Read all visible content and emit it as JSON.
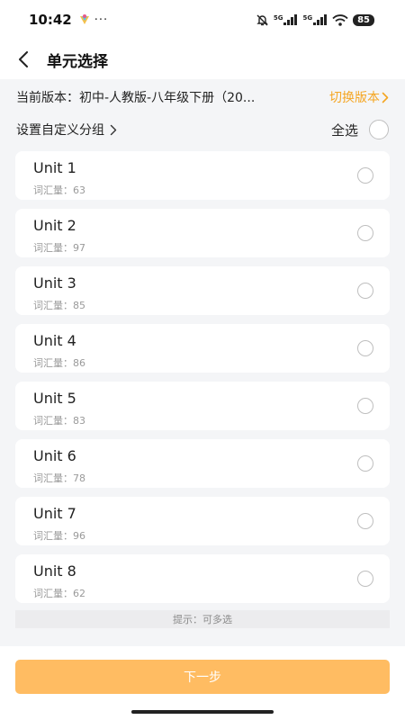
{
  "status_bar": {
    "time": "10:42",
    "dots": "···",
    "network_label_1": "5G",
    "network_label_2": "5G",
    "battery": "85"
  },
  "header": {
    "title": "单元选择"
  },
  "version": {
    "text": "当前版本：初中-人教版-八年级下册（20...",
    "switch_label": "切换版本"
  },
  "group": {
    "custom_label": "设置自定义分组",
    "select_all_label": "全选"
  },
  "units": [
    {
      "name": "Unit 1",
      "count": "词汇量：63"
    },
    {
      "name": "Unit 2",
      "count": "词汇量：97"
    },
    {
      "name": "Unit 3",
      "count": "词汇量：85"
    },
    {
      "name": "Unit 4",
      "count": "词汇量：86"
    },
    {
      "name": "Unit 5",
      "count": "词汇量：83"
    },
    {
      "name": "Unit 6",
      "count": "词汇量：78"
    },
    {
      "name": "Unit 7",
      "count": "词汇量：96"
    },
    {
      "name": "Unit 8",
      "count": "词汇量：62"
    }
  ],
  "hint": "提示：可多选",
  "footer": {
    "next_label": "下一步"
  },
  "colors": {
    "accent": "#f5a623",
    "button": "#ffbc62",
    "background": "#f4f5f7"
  }
}
